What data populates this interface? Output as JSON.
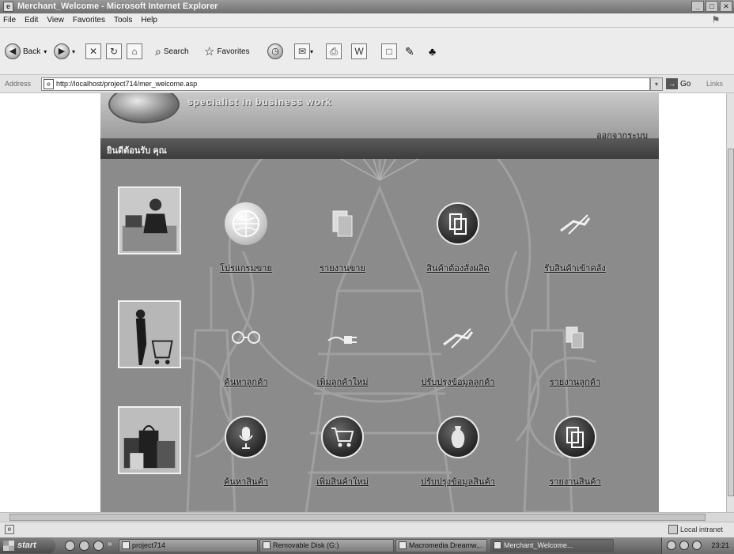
{
  "window": {
    "title": "Merchant_Welcome - Microsoft Internet Explorer",
    "buttons": [
      "_",
      "□",
      "✕"
    ]
  },
  "menubar": {
    "items": [
      "File",
      "Edit",
      "View",
      "Favorites",
      "Tools",
      "Help"
    ]
  },
  "toolbar": {
    "back": "Back",
    "search": "Search",
    "favorites": "Favorites"
  },
  "address": {
    "label": "Address",
    "url": "http://localhost/project714/mer_welcome.asp",
    "go": "Go",
    "links": "Links"
  },
  "page": {
    "slogan": "specialist in business work",
    "logout": "ออกจากระบบ",
    "welcome": "ยินดีต้อนรับ คุณ",
    "menu": [
      {
        "label": "โปรแกรมขาย",
        "icon": "globe-icon",
        "style": "light"
      },
      {
        "label": "รายงานขาย",
        "icon": "document-icon",
        "style": "plain"
      },
      {
        "label": "สินค้าต้องสั่งผลิต",
        "icon": "documents-icon",
        "style": "dark"
      },
      {
        "label": "รับสินค้าเข้าคลัง",
        "icon": "pen-hand-icon",
        "style": "plain"
      },
      {
        "label": "ค้นหาลูกค้า",
        "icon": "glasses-icon",
        "style": "plain"
      },
      {
        "label": "เพิ่มลูกค้าใหม่",
        "icon": "plug-icon",
        "style": "plain"
      },
      {
        "label": "ปรับปรุงข้อมูลลูกค้า",
        "icon": "pen-hand-icon",
        "style": "plain"
      },
      {
        "label": "รายงานลูกค้า",
        "icon": "documents-icon",
        "style": "plain"
      },
      {
        "label": "ค้นหาสินค้า",
        "icon": "microphone-icon",
        "style": "dark"
      },
      {
        "label": "เพิ่มสินค้าใหม่",
        "icon": "shopping-cart-icon",
        "style": "dark"
      },
      {
        "label": "ปรับปรุงข้อมูลสินค้า",
        "icon": "vase-icon",
        "style": "dark"
      },
      {
        "label": "รายงานสินค้า",
        "icon": "documents-icon",
        "style": "dark"
      }
    ]
  },
  "status": {
    "zone": "Local intranet"
  },
  "taskbar": {
    "start": "start",
    "tasks": [
      "project714",
      "Removable Disk (G:)",
      "Macromedia Dreamw...",
      "Merchant_Welcome..."
    ],
    "clock": "23:21"
  }
}
